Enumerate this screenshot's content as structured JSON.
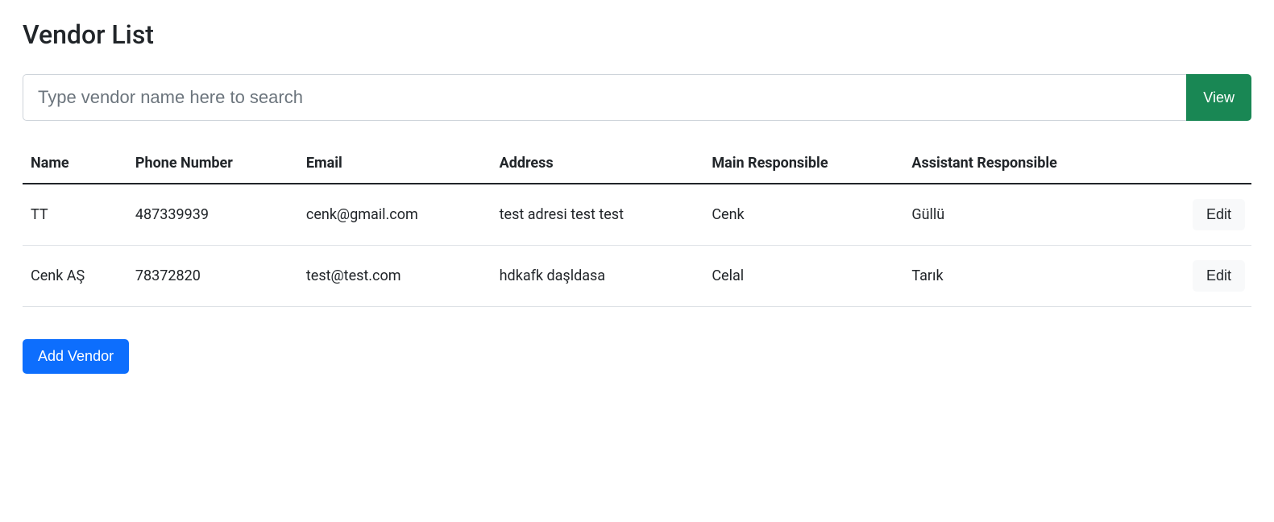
{
  "page": {
    "title": "Vendor List"
  },
  "search": {
    "placeholder": "Type vendor name here to search",
    "value": "",
    "viewLabel": "View"
  },
  "table": {
    "headers": {
      "name": "Name",
      "phone": "Phone Number",
      "email": "Email",
      "address": "Address",
      "mainResponsible": "Main Responsible",
      "assistantResponsible": "Assistant Responsible"
    },
    "rows": [
      {
        "name": "TT",
        "phone": "487339939",
        "email": "cenk@gmail.com",
        "address": "test adresi test test",
        "mainResponsible": "Cenk",
        "assistantResponsible": "Güllü",
        "editLabel": "Edit"
      },
      {
        "name": "Cenk AŞ",
        "phone": "78372820",
        "email": "test@test.com",
        "address": "hdkafk daşldasa",
        "mainResponsible": "Celal",
        "assistantResponsible": "Tarık",
        "editLabel": "Edit"
      }
    ]
  },
  "actions": {
    "addVendorLabel": "Add Vendor"
  }
}
